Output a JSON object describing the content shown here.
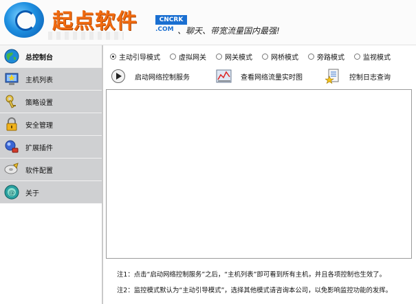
{
  "header": {
    "brand": "起点软件",
    "brand_badge": "CNCRK",
    "brand_domain": ".COM",
    "slogan": "、聊天、带宽流量国内最强!"
  },
  "sidebar": {
    "items": [
      {
        "label": "总控制台",
        "icon": "globe-icon",
        "active": true
      },
      {
        "label": "主机列表",
        "icon": "host-list-icon",
        "active": false
      },
      {
        "label": "策略设置",
        "icon": "key-icon",
        "active": false
      },
      {
        "label": "安全管理",
        "icon": "lock-icon",
        "active": false
      },
      {
        "label": "扩展插件",
        "icon": "plugin-icon",
        "active": false
      },
      {
        "label": "软件配置",
        "icon": "disc-config-icon",
        "active": false
      },
      {
        "label": "关于",
        "icon": "about-icon",
        "active": false
      }
    ]
  },
  "modes": [
    {
      "label": "主动引导模式",
      "selected": true
    },
    {
      "label": "虚拟网关",
      "selected": false
    },
    {
      "label": "网关模式",
      "selected": false
    },
    {
      "label": "网桥模式",
      "selected": false
    },
    {
      "label": "旁路模式",
      "selected": false
    },
    {
      "label": "监视模式",
      "selected": false
    }
  ],
  "toolbar": {
    "start_label": "启动网络控制服务",
    "traffic_label": "查看网络流量实时图",
    "log_label": "控制日志查询"
  },
  "notes": {
    "note1": "注1：点击“启动网络控制服务”之后，“主机列表”即可看到所有主机，并且各项控制也生效了。",
    "note2": "注2：监控模式默认为“主动引导模式”，选择其他模式请咨询本公司，以免影响监控功能的发挥。"
  },
  "colors": {
    "sidebar_bg": "#cfd0d2",
    "sidebar_active_bg": "#f5f5f5",
    "brand_orange": "#f06a10",
    "brand_blue": "#1a6fd1"
  }
}
